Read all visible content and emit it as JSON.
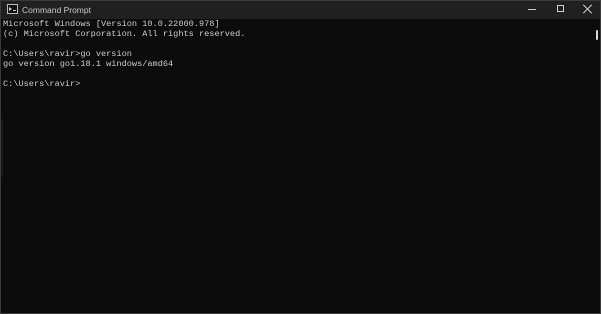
{
  "window": {
    "title": "Command Prompt",
    "app_icon": "terminal-icon",
    "controls": {
      "minimize": "minimize-icon",
      "maximize": "maximize-icon",
      "close": "close-icon"
    }
  },
  "console": {
    "lines": [
      "Microsoft Windows [Version 10.0.22000.978]",
      "(c) Microsoft Corporation. All rights reserved.",
      "",
      "C:\\Users\\ravir>go version",
      "go version go1.18.1 windows/amd64",
      "",
      "C:\\Users\\ravir>"
    ]
  },
  "colors": {
    "background": "#0c0c0c",
    "titlebar": "#202020",
    "text": "#cccccc"
  }
}
